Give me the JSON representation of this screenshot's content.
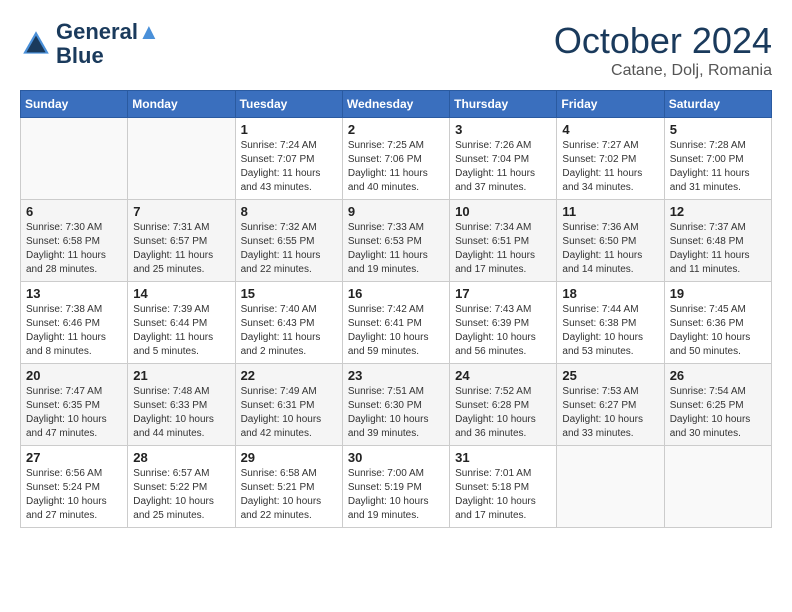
{
  "header": {
    "logo_line1": "General",
    "logo_line2": "Blue",
    "month": "October 2024",
    "location": "Catane, Dolj, Romania"
  },
  "weekdays": [
    "Sunday",
    "Monday",
    "Tuesday",
    "Wednesday",
    "Thursday",
    "Friday",
    "Saturday"
  ],
  "weeks": [
    [
      {
        "day": "",
        "info": ""
      },
      {
        "day": "",
        "info": ""
      },
      {
        "day": "1",
        "info": "Sunrise: 7:24 AM\nSunset: 7:07 PM\nDaylight: 11 hours\nand 43 minutes."
      },
      {
        "day": "2",
        "info": "Sunrise: 7:25 AM\nSunset: 7:06 PM\nDaylight: 11 hours\nand 40 minutes."
      },
      {
        "day": "3",
        "info": "Sunrise: 7:26 AM\nSunset: 7:04 PM\nDaylight: 11 hours\nand 37 minutes."
      },
      {
        "day": "4",
        "info": "Sunrise: 7:27 AM\nSunset: 7:02 PM\nDaylight: 11 hours\nand 34 minutes."
      },
      {
        "day": "5",
        "info": "Sunrise: 7:28 AM\nSunset: 7:00 PM\nDaylight: 11 hours\nand 31 minutes."
      }
    ],
    [
      {
        "day": "6",
        "info": "Sunrise: 7:30 AM\nSunset: 6:58 PM\nDaylight: 11 hours\nand 28 minutes."
      },
      {
        "day": "7",
        "info": "Sunrise: 7:31 AM\nSunset: 6:57 PM\nDaylight: 11 hours\nand 25 minutes."
      },
      {
        "day": "8",
        "info": "Sunrise: 7:32 AM\nSunset: 6:55 PM\nDaylight: 11 hours\nand 22 minutes."
      },
      {
        "day": "9",
        "info": "Sunrise: 7:33 AM\nSunset: 6:53 PM\nDaylight: 11 hours\nand 19 minutes."
      },
      {
        "day": "10",
        "info": "Sunrise: 7:34 AM\nSunset: 6:51 PM\nDaylight: 11 hours\nand 17 minutes."
      },
      {
        "day": "11",
        "info": "Sunrise: 7:36 AM\nSunset: 6:50 PM\nDaylight: 11 hours\nand 14 minutes."
      },
      {
        "day": "12",
        "info": "Sunrise: 7:37 AM\nSunset: 6:48 PM\nDaylight: 11 hours\nand 11 minutes."
      }
    ],
    [
      {
        "day": "13",
        "info": "Sunrise: 7:38 AM\nSunset: 6:46 PM\nDaylight: 11 hours\nand 8 minutes."
      },
      {
        "day": "14",
        "info": "Sunrise: 7:39 AM\nSunset: 6:44 PM\nDaylight: 11 hours\nand 5 minutes."
      },
      {
        "day": "15",
        "info": "Sunrise: 7:40 AM\nSunset: 6:43 PM\nDaylight: 11 hours\nand 2 minutes."
      },
      {
        "day": "16",
        "info": "Sunrise: 7:42 AM\nSunset: 6:41 PM\nDaylight: 10 hours\nand 59 minutes."
      },
      {
        "day": "17",
        "info": "Sunrise: 7:43 AM\nSunset: 6:39 PM\nDaylight: 10 hours\nand 56 minutes."
      },
      {
        "day": "18",
        "info": "Sunrise: 7:44 AM\nSunset: 6:38 PM\nDaylight: 10 hours\nand 53 minutes."
      },
      {
        "day": "19",
        "info": "Sunrise: 7:45 AM\nSunset: 6:36 PM\nDaylight: 10 hours\nand 50 minutes."
      }
    ],
    [
      {
        "day": "20",
        "info": "Sunrise: 7:47 AM\nSunset: 6:35 PM\nDaylight: 10 hours\nand 47 minutes."
      },
      {
        "day": "21",
        "info": "Sunrise: 7:48 AM\nSunset: 6:33 PM\nDaylight: 10 hours\nand 44 minutes."
      },
      {
        "day": "22",
        "info": "Sunrise: 7:49 AM\nSunset: 6:31 PM\nDaylight: 10 hours\nand 42 minutes."
      },
      {
        "day": "23",
        "info": "Sunrise: 7:51 AM\nSunset: 6:30 PM\nDaylight: 10 hours\nand 39 minutes."
      },
      {
        "day": "24",
        "info": "Sunrise: 7:52 AM\nSunset: 6:28 PM\nDaylight: 10 hours\nand 36 minutes."
      },
      {
        "day": "25",
        "info": "Sunrise: 7:53 AM\nSunset: 6:27 PM\nDaylight: 10 hours\nand 33 minutes."
      },
      {
        "day": "26",
        "info": "Sunrise: 7:54 AM\nSunset: 6:25 PM\nDaylight: 10 hours\nand 30 minutes."
      }
    ],
    [
      {
        "day": "27",
        "info": "Sunrise: 6:56 AM\nSunset: 5:24 PM\nDaylight: 10 hours\nand 27 minutes."
      },
      {
        "day": "28",
        "info": "Sunrise: 6:57 AM\nSunset: 5:22 PM\nDaylight: 10 hours\nand 25 minutes."
      },
      {
        "day": "29",
        "info": "Sunrise: 6:58 AM\nSunset: 5:21 PM\nDaylight: 10 hours\nand 22 minutes."
      },
      {
        "day": "30",
        "info": "Sunrise: 7:00 AM\nSunset: 5:19 PM\nDaylight: 10 hours\nand 19 minutes."
      },
      {
        "day": "31",
        "info": "Sunrise: 7:01 AM\nSunset: 5:18 PM\nDaylight: 10 hours\nand 17 minutes."
      },
      {
        "day": "",
        "info": ""
      },
      {
        "day": "",
        "info": ""
      }
    ]
  ]
}
